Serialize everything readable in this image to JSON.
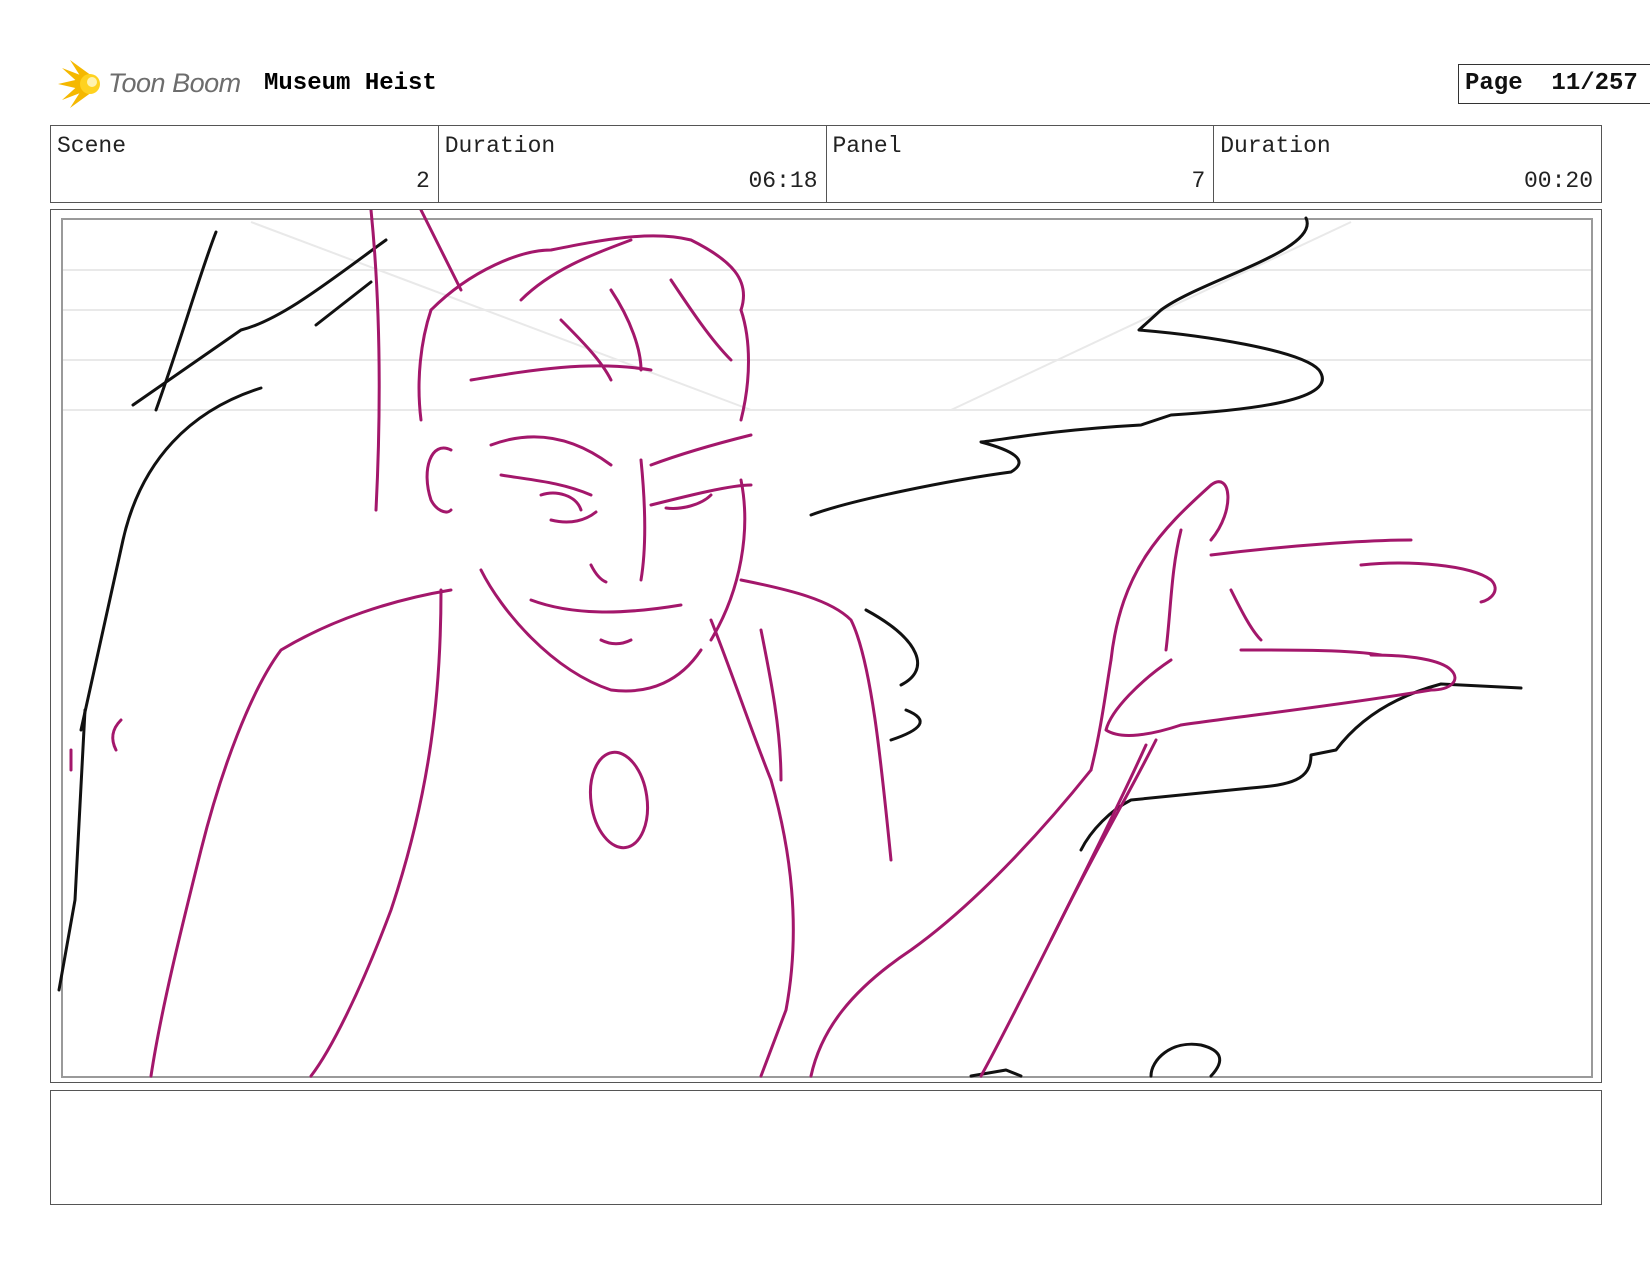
{
  "header": {
    "brand": "Toon Boom",
    "project_title": "Museum Heist",
    "page_label": "Page",
    "page_value": "11/257"
  },
  "info": {
    "scene_label": "Scene",
    "scene_value": "2",
    "scene_duration_label": "Duration",
    "scene_duration_value": "06:18",
    "panel_label": "Panel",
    "panel_value": "7",
    "panel_duration_label": "Duration",
    "panel_duration_value": "00:20"
  },
  "panel": {
    "sketch_color_character": "#a3176b",
    "sketch_color_background": "#111111"
  },
  "icons": {
    "logo": "toon-boom-logo-icon"
  },
  "notes": {
    "text": ""
  }
}
